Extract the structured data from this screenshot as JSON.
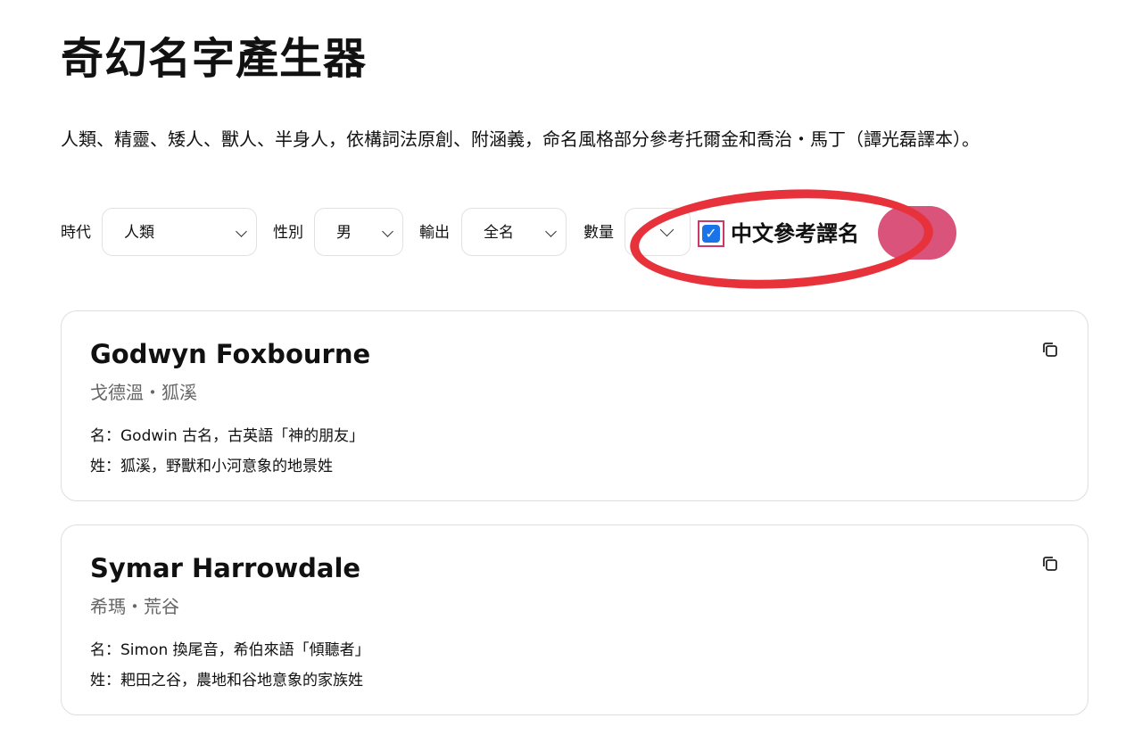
{
  "page": {
    "title": "奇幻名字產生器",
    "description": "人類、精靈、矮人、獸人、半身人，依構詞法原創、附涵義，命名風格部分參考托爾金和喬治・馬丁（譚光磊譯本）。"
  },
  "controls": {
    "era_label": "時代",
    "era_value": "人類",
    "gender_label": "性別",
    "gender_value": "男",
    "output_label": "輸出",
    "output_value": "全名",
    "count_label": "數量",
    "count_value": "",
    "chinese_ref_label": "中文參考譯名",
    "chinese_ref_checked": true,
    "generate_label": ""
  },
  "results": [
    {
      "name": "Godwyn Foxbourne",
      "translation": "戈德溫・狐溪",
      "given_note": "名：Godwin 古名，古英語「神的朋友」",
      "surname_note": "姓：狐溪，野獸和小河意象的地景姓"
    },
    {
      "name": "Symar Harrowdale",
      "translation": "希瑪・荒谷",
      "given_note": "名：Simon 換尾音，希伯來語「傾聽者」",
      "surname_note": "姓：耙田之谷，農地和谷地意象的家族姓"
    }
  ],
  "colors": {
    "accent": "#d9537a",
    "checkbox": "#1a73e8",
    "annotation_ring": "#e8323b"
  },
  "icons": {
    "copy": "copy-icon",
    "chevron": "chevron-down-icon",
    "check": "checkmark-icon"
  }
}
